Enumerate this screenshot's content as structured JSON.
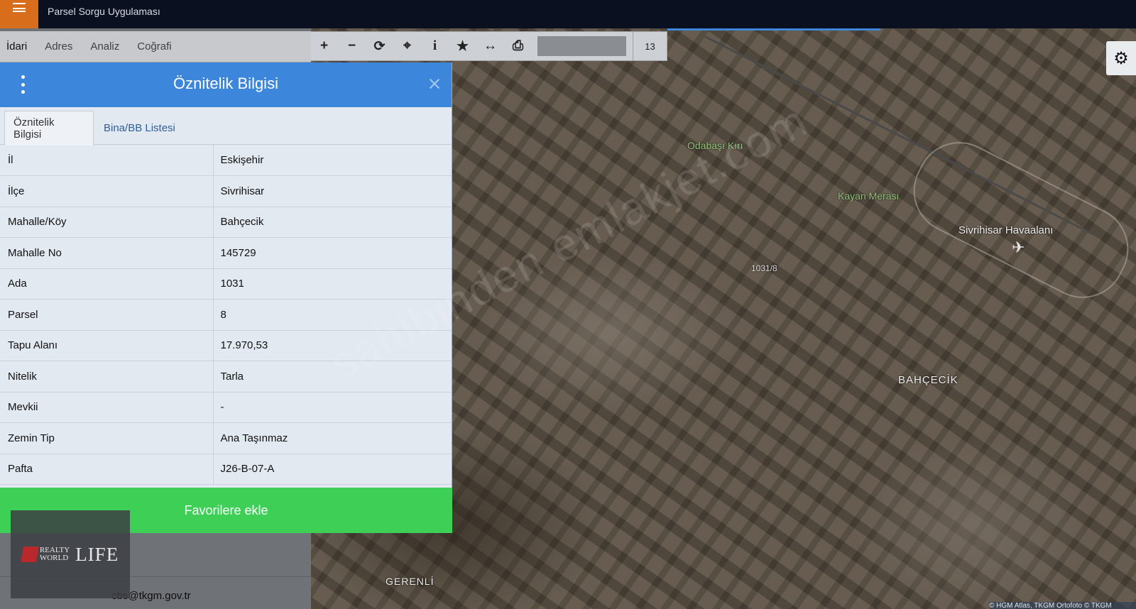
{
  "header": {
    "title": "Parsel Sorgu Uygulaması"
  },
  "nav": {
    "tabs": [
      "İdari",
      "Adres",
      "Analiz",
      "Coğrafi"
    ]
  },
  "dialog": {
    "title": "Öznitelik Bilgisi",
    "tabs": [
      "Öznitelik Bilgisi",
      "Bina/BB Listesi"
    ],
    "rows": [
      {
        "key": "İl",
        "value": "Eskişehir"
      },
      {
        "key": "İlçe",
        "value": "Sivrihisar"
      },
      {
        "key": "Mahalle/Köy",
        "value": "Bahçecik"
      },
      {
        "key": "Mahalle No",
        "value": "145729"
      },
      {
        "key": "Ada",
        "value": "1031"
      },
      {
        "key": "Parsel",
        "value": "8"
      },
      {
        "key": "Tapu Alanı",
        "value": "17.970,53"
      },
      {
        "key": "Nitelik",
        "value": "Tarla"
      },
      {
        "key": "Mevkii",
        "value": "-"
      },
      {
        "key": "Zemin Tip",
        "value": "Ana Taşınmaz"
      },
      {
        "key": "Pafta",
        "value": "J26-B-07-A"
      }
    ],
    "fav_button": "Favorilere ekle"
  },
  "toolbar": {
    "tools": [
      {
        "icon": "zoom-in-icon",
        "glyph": "+"
      },
      {
        "icon": "zoom-out-icon",
        "glyph": "−"
      },
      {
        "icon": "refresh-icon",
        "glyph": "⟳"
      },
      {
        "icon": "locate-icon",
        "glyph": "⌖"
      },
      {
        "icon": "info-icon",
        "glyph": "i"
      },
      {
        "icon": "star-icon",
        "glyph": "★"
      },
      {
        "icon": "measure-icon",
        "glyph": "↔"
      },
      {
        "icon": "print-icon",
        "glyph": "⎙"
      }
    ],
    "zoom_level": "13"
  },
  "map": {
    "labels": [
      "Sivrihisar Havaalanı",
      "BAHÇECİK",
      "GERENLİ"
    ],
    "green_labels": [
      "Odabaşı Kırı",
      "Kayan Merası"
    ],
    "parcel_label": "1031/8",
    "attribution": "© HGM Atlas, TKGM Ortofoto © TKGM",
    "watermark": "sahibinden emlakjet.com"
  },
  "footer": {
    "email": "cbs@tkgm.gov.tr"
  },
  "logo": {
    "brand_line1": "REALTY",
    "brand_line2": "WORLD",
    "brand_life": "LIFE"
  },
  "colors": {
    "accent": "#3c86db",
    "favorite": "#3ecf57",
    "menu": "#d86d1c"
  }
}
